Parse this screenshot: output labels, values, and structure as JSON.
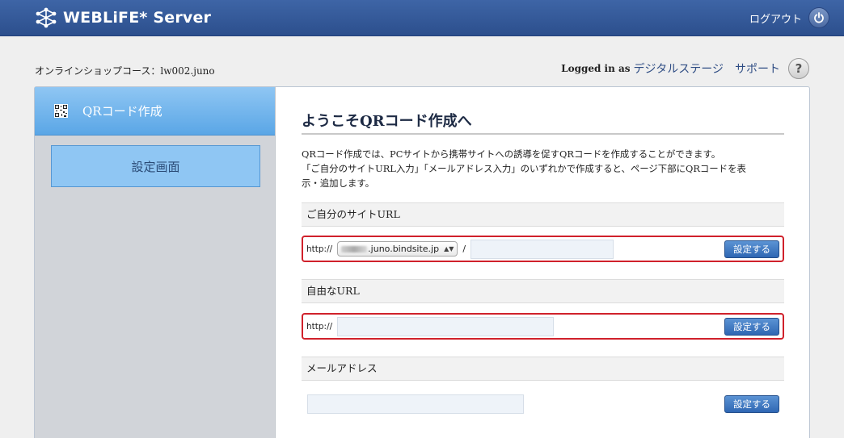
{
  "header": {
    "app_title": "WEBLiFE* Server",
    "logout_label": "ログアウト"
  },
  "subheader": {
    "course": "オンラインショップコース：lw002.juno",
    "logged_in_label": "Logged in as",
    "user_name": "デジタルステージ",
    "support_label": "サポート",
    "help_symbol": "?"
  },
  "sidebar": {
    "title": "QRコード作成",
    "settings_button": "設定画面"
  },
  "main": {
    "title": "ようこそQRコード作成へ",
    "description_line1": "QRコード作成では、PCサイトから携帯サイトへの誘導を促すQRコードを作成することができます。",
    "description_line2": "「ご自分のサイトURL入力」「メールアドレス入力」のいずれかで作成すると、ページ下部にQRコードを表",
    "description_line3": "示・追加します。",
    "sections": {
      "site_url": {
        "heading": "ご自分のサイトURL",
        "protocol": "http://",
        "domain_select_value": ".juno.bindsite.jp",
        "separator": "/",
        "path_value": "",
        "button": "設定する"
      },
      "free_url": {
        "heading": "自由なURL",
        "protocol": "http://",
        "url_value": "",
        "button": "設定する"
      },
      "email": {
        "heading": "メールアドレス",
        "email_value": "",
        "button": "設定する"
      }
    }
  },
  "colors": {
    "header_bg": "#2c4f8d",
    "sidebar_accent": "#5aa6e6",
    "highlight_border": "#d0212b",
    "button_bg": "#2f67b3"
  }
}
